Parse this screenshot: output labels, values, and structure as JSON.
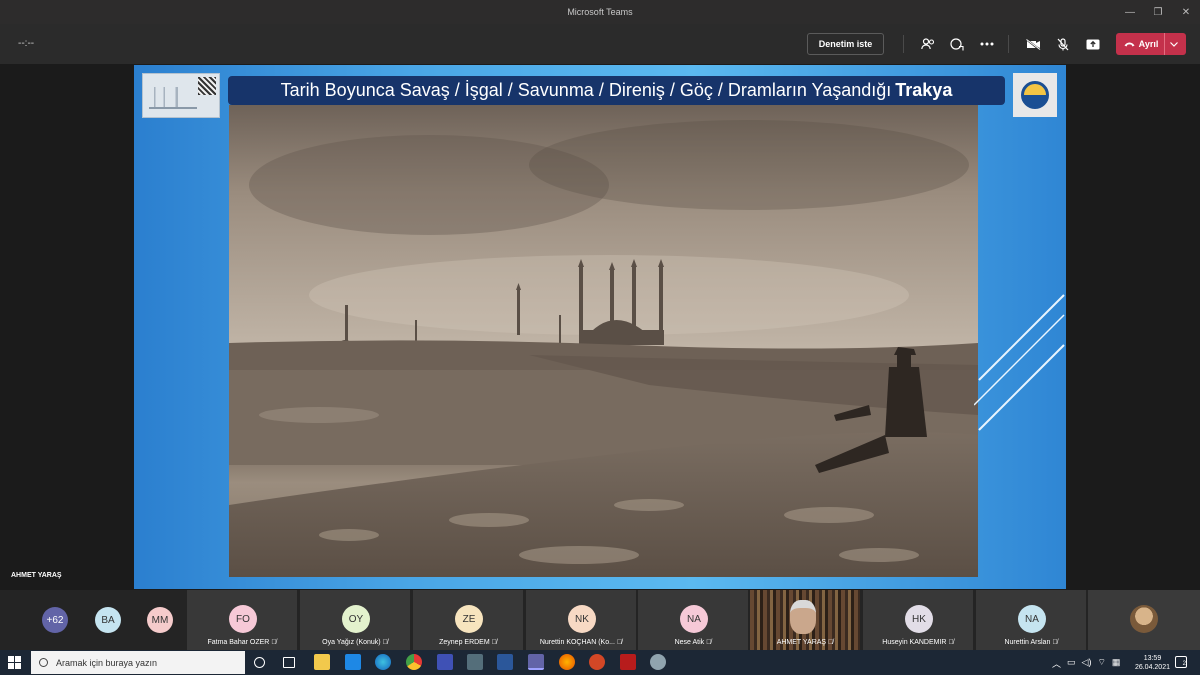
{
  "window": {
    "title": "Microsoft Teams"
  },
  "toolbar": {
    "timer": "--:--",
    "request_control_label": "Denetim iste",
    "leave_label": "Ayrıl",
    "leave_color": "#c4314b"
  },
  "slide": {
    "title_main": "Tarih Boyunca Savaş / İşgal / Savunma / Direniş / Göç / Dramların Yaşandığı",
    "title_bold": "Trakya",
    "banner_color": "#17346a"
  },
  "speaker": {
    "name": "AHMET YARAŞ"
  },
  "participants": {
    "overflow": "+62",
    "small": [
      {
        "initials": "BA",
        "color": "#c5e4f0"
      },
      {
        "initials": "MM",
        "color": "#f5cbcb"
      }
    ],
    "tiles": [
      {
        "initials": "FO",
        "name": "Fatma Bahar OZER",
        "color": "#f6c9d7"
      },
      {
        "initials": "OY",
        "name": "Oya Yağız (Konuk)",
        "color": "#e3f2cd"
      },
      {
        "initials": "ZE",
        "name": "Zeynep ERDEM",
        "color": "#f7e4be"
      },
      {
        "initials": "NK",
        "name": "Nurettin KOÇHAN (Ko...",
        "color": "#f7d9c4"
      },
      {
        "initials": "NA",
        "name": "Nese Atik",
        "color": "#f6c9d7"
      },
      {
        "initials": "",
        "name": "AHMET YARAŞ",
        "video": true
      },
      {
        "initials": "HK",
        "name": "Huseyin KANDEMIR",
        "color": "#e2dde7"
      },
      {
        "initials": "NA",
        "name": "Nurettin Arslan",
        "color": "#c5e4f0"
      }
    ]
  },
  "taskbar": {
    "search_placeholder": "Aramak için buraya yazın",
    "time": "13:59",
    "date": "26.04.2021"
  }
}
